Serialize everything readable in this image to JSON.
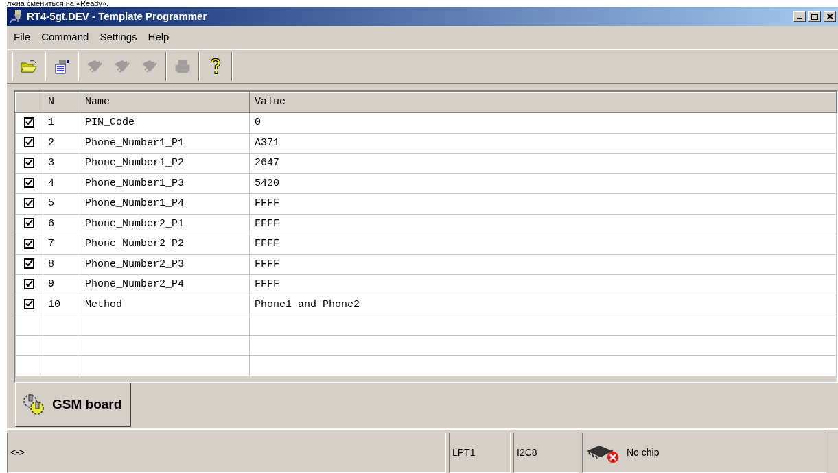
{
  "caption": "лжна смениться на «Ready».",
  "window": {
    "title": "RT4-5gt.DEV - Template Programmer"
  },
  "menu": [
    "File",
    "Command",
    "Settings",
    "Help"
  ],
  "toolbar": [
    {
      "kind": "open",
      "disabled": false
    },
    {
      "kind": "properties",
      "disabled": false
    },
    {
      "kind": "chip",
      "disabled": true
    },
    {
      "kind": "chip",
      "disabled": true
    },
    {
      "kind": "chip",
      "disabled": true
    },
    {
      "kind": "print",
      "disabled": true
    },
    {
      "kind": "help",
      "disabled": false
    }
  ],
  "table": {
    "columns": [
      "N",
      "Name",
      "Value"
    ],
    "rows": [
      {
        "checked": true,
        "n": "1",
        "name": "PIN_Code",
        "value": "0"
      },
      {
        "checked": true,
        "n": "2",
        "name": "Phone_Number1_P1",
        "value": "A371"
      },
      {
        "checked": true,
        "n": "3",
        "name": "Phone_Number1_P2",
        "value": "2647"
      },
      {
        "checked": true,
        "n": "4",
        "name": "Phone_Number1_P3",
        "value": "5420"
      },
      {
        "checked": true,
        "n": "5",
        "name": "Phone_Number1_P4",
        "value": "FFFF"
      },
      {
        "checked": true,
        "n": "6",
        "name": "Phone_Number2_P1",
        "value": "FFFF"
      },
      {
        "checked": true,
        "n": "7",
        "name": "Phone_Number2_P2",
        "value": "FFFF"
      },
      {
        "checked": true,
        "n": "8",
        "name": "Phone_Number2_P3",
        "value": "FFFF"
      },
      {
        "checked": true,
        "n": "9",
        "name": "Phone_Number2_P4",
        "value": "FFFF"
      },
      {
        "checked": true,
        "n": "10",
        "name": "Method",
        "value": "Phone1 and Phone2"
      }
    ]
  },
  "tabs": [
    {
      "label": "GSM board",
      "selected": true
    }
  ],
  "status_bar": {
    "message": "<->",
    "port": "LPT1",
    "bus": "I2C8",
    "chip": "No chip"
  }
}
